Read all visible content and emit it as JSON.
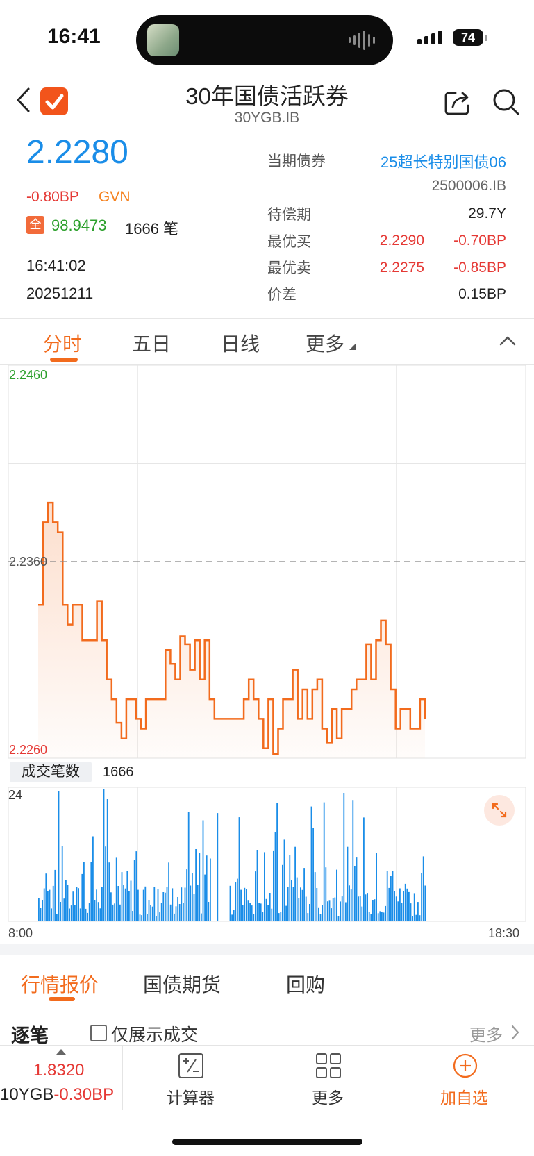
{
  "status_bar": {
    "time": "16:41",
    "battery": "74"
  },
  "header": {
    "title": "30年国债活跃券",
    "subtitle": "30YGB.IB"
  },
  "quote": {
    "price": "2.2280",
    "change": "-0.80BP",
    "source": "GVN",
    "full_badge": "全",
    "clean_price": "98.9473",
    "deals": "1666 笔",
    "time": "16:41:02",
    "date": "20251211"
  },
  "details": {
    "current_bond_label": "当期债券",
    "current_bond_value": "25超长特别国债06",
    "bond_code": "2500006.IB",
    "maturity_label": "待偿期",
    "maturity_value": "29.7Y",
    "best_bid_label": "最优买",
    "best_bid_price": "2.2290",
    "best_bid_change": "-0.70BP",
    "best_ask_label": "最优卖",
    "best_ask_price": "2.2275",
    "best_ask_change": "-0.85BP",
    "spread_label": "价差",
    "spread_value": "0.15BP"
  },
  "chart_tabs": [
    "分时",
    "五日",
    "日线",
    "更多"
  ],
  "chart_data": {
    "type": "line",
    "y_max_label": "2.2460",
    "y_ref_label": "2.2360",
    "y_min_label": "2.2260",
    "ylim": [
      2.226,
      2.246
    ],
    "reference": 2.236,
    "x_start": "8:00",
    "x_end": "18:30",
    "series": [
      {
        "values": [
          2.2338,
          2.238,
          2.239,
          2.238,
          2.2375,
          2.2338,
          2.2328,
          2.2338,
          2.2338,
          2.232,
          2.232,
          2.232,
          2.234,
          2.232,
          2.23,
          2.229,
          2.2278,
          2.227,
          2.229,
          2.229,
          2.228,
          2.2275,
          2.229,
          2.229,
          2.229,
          2.229,
          2.2315,
          2.2308,
          2.23,
          2.2322,
          2.2318,
          2.2305,
          2.232,
          2.23,
          2.232,
          2.229,
          2.228,
          2.228,
          2.228,
          2.228,
          2.228,
          2.228,
          2.229,
          2.23,
          2.229,
          2.228,
          2.2265,
          2.229,
          2.2262,
          2.2275,
          2.229,
          2.229,
          2.2305,
          2.228,
          2.2295,
          2.228,
          2.2295,
          2.23,
          2.2275,
          2.2268,
          2.2285,
          2.227,
          2.2285,
          2.2285,
          2.2295,
          2.23,
          2.23,
          2.2318,
          2.23,
          2.232,
          2.233,
          2.2318,
          2.2295,
          2.2275,
          2.2285,
          2.2285,
          2.2275,
          2.2275,
          2.229,
          2.228
        ],
        "color": "#f26b1d"
      }
    ]
  },
  "volume": {
    "label": "成交笔数",
    "count": "1666",
    "max_label": "24"
  },
  "section_tabs": [
    "行情报价",
    "国债期货",
    "回购"
  ],
  "ticks_section": {
    "title": "逐笔",
    "checkbox_label": "仅展示成交",
    "more": "更多"
  },
  "bottom_bar": {
    "price": "1.8320",
    "name": "10YGB",
    "change": "-0.30BP",
    "calc_label": "计算器",
    "more_label": "更多",
    "add_label": "加自选"
  },
  "colors": {
    "accent": "#f26b1d",
    "blue": "#1a8de8",
    "red": "#e53935",
    "green": "#2ca02c"
  }
}
